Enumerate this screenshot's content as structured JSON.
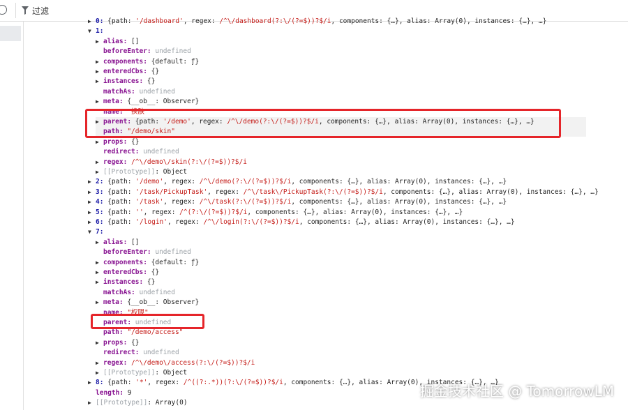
{
  "toolbar": {
    "filter_label": "过滤"
  },
  "rows": [
    {
      "tri": "▶",
      "indent": 0,
      "parts": [
        [
          "kidx",
          "0: "
        ],
        [
          "o",
          "{path: "
        ],
        [
          "s",
          "'/dashboard'"
        ],
        [
          "o",
          ", regex: "
        ],
        [
          "s",
          "/^\\/dashboard(?:\\/(?=$))?$/i"
        ],
        [
          "o",
          ", components: {…}, alias: Array(0), instances: {…},  …}"
        ]
      ]
    },
    {
      "tri": "▼",
      "indent": 0,
      "parts": [
        [
          "kidx",
          "1:"
        ]
      ]
    },
    {
      "tri": "▶",
      "indent": 1,
      "parts": [
        [
          "k",
          "alias: "
        ],
        [
          "o",
          "[]"
        ]
      ]
    },
    {
      "tri": "",
      "indent": 1,
      "parts": [
        [
          "k",
          "beforeEnter: "
        ],
        [
          "u",
          "undefined"
        ]
      ]
    },
    {
      "tri": "▶",
      "indent": 1,
      "parts": [
        [
          "k",
          "components: "
        ],
        [
          "o",
          "{default: ƒ}"
        ]
      ]
    },
    {
      "tri": "▶",
      "indent": 1,
      "parts": [
        [
          "k",
          "enteredCbs: "
        ],
        [
          "o",
          "{}"
        ]
      ]
    },
    {
      "tri": "▶",
      "indent": 1,
      "parts": [
        [
          "k",
          "instances: "
        ],
        [
          "o",
          "{}"
        ]
      ]
    },
    {
      "tri": "",
      "indent": 1,
      "parts": [
        [
          "k",
          "matchAs: "
        ],
        [
          "u",
          "undefined"
        ]
      ]
    },
    {
      "tri": "▶",
      "indent": 1,
      "parts": [
        [
          "k",
          "meta: "
        ],
        [
          "o",
          "{__ob__: Observer}"
        ]
      ]
    },
    {
      "tri": "",
      "indent": 1,
      "parts": [
        [
          "k",
          "name: "
        ],
        [
          "s",
          "\"换肤\""
        ]
      ]
    },
    {
      "tri": "▶",
      "indent": 1,
      "hl": true,
      "parts": [
        [
          "k",
          "parent: "
        ],
        [
          "o",
          "{path: "
        ],
        [
          "s",
          "'/demo'"
        ],
        [
          "o",
          ", regex: "
        ],
        [
          "s",
          "/^\\/demo(?:\\/(?=$))?$/i"
        ],
        [
          "o",
          ", components: {…}, alias: Array(0), instances: {…},  …}"
        ]
      ]
    },
    {
      "tri": "",
      "indent": 1,
      "hl": true,
      "parts": [
        [
          "k",
          "path: "
        ],
        [
          "s",
          "\"/demo/skin\""
        ]
      ]
    },
    {
      "tri": "▶",
      "indent": 1,
      "parts": [
        [
          "k",
          "props: "
        ],
        [
          "o",
          "{}"
        ]
      ]
    },
    {
      "tri": "",
      "indent": 1,
      "parts": [
        [
          "k",
          "redirect: "
        ],
        [
          "u",
          "undefined"
        ]
      ]
    },
    {
      "tri": "▶",
      "indent": 1,
      "parts": [
        [
          "k",
          "regex: "
        ],
        [
          "s",
          "/^\\/demo\\/skin(?:\\/(?=$))?$/i"
        ]
      ]
    },
    {
      "tri": "▶",
      "indent": 1,
      "parts": [
        [
          "u",
          "[[Prototype]]"
        ],
        [
          "o",
          ": Object"
        ]
      ]
    },
    {
      "tri": "▶",
      "indent": 0,
      "parts": [
        [
          "kidx",
          "2: "
        ],
        [
          "o",
          "{path: "
        ],
        [
          "s",
          "'/demo'"
        ],
        [
          "o",
          ", regex: "
        ],
        [
          "s",
          "/^\\/demo(?:\\/(?=$))?$/i"
        ],
        [
          "o",
          ", components: {…}, alias: Array(0), instances: {…},  …}"
        ]
      ]
    },
    {
      "tri": "▶",
      "indent": 0,
      "parts": [
        [
          "kidx",
          "3: "
        ],
        [
          "o",
          "{path: "
        ],
        [
          "s",
          "'/task/PickupTask'"
        ],
        [
          "o",
          ", regex: "
        ],
        [
          "s",
          "/^\\/task\\/PickupTask(?:\\/(?=$))?$/i"
        ],
        [
          "o",
          ", components: {…}, alias: Array(0), instances: {…},  …}"
        ]
      ]
    },
    {
      "tri": "▶",
      "indent": 0,
      "parts": [
        [
          "kidx",
          "4: "
        ],
        [
          "o",
          "{path: "
        ],
        [
          "s",
          "'/task'"
        ],
        [
          "o",
          ", regex: "
        ],
        [
          "s",
          "/^\\/task(?:\\/(?=$))?$/i"
        ],
        [
          "o",
          ", components: {…}, alias: Array(0), instances: {…},  …}"
        ]
      ]
    },
    {
      "tri": "▶",
      "indent": 0,
      "parts": [
        [
          "kidx",
          "5: "
        ],
        [
          "o",
          "{path: "
        ],
        [
          "s",
          "''"
        ],
        [
          "o",
          ", regex: "
        ],
        [
          "s",
          "/^(?:\\/(?=$))?$/i"
        ],
        [
          "o",
          ", components: {…}, alias: Array(0), instances: {…},  …}"
        ]
      ]
    },
    {
      "tri": "▶",
      "indent": 0,
      "parts": [
        [
          "kidx",
          "6: "
        ],
        [
          "o",
          "{path: "
        ],
        [
          "s",
          "'/login'"
        ],
        [
          "o",
          ", regex: "
        ],
        [
          "s",
          "/^\\/login(?:\\/(?=$))?$/i"
        ],
        [
          "o",
          ", components: {…}, alias: Array(0), instances: {…},  …}"
        ]
      ]
    },
    {
      "tri": "▼",
      "indent": 0,
      "parts": [
        [
          "kidx",
          "7:"
        ]
      ]
    },
    {
      "tri": "▶",
      "indent": 1,
      "parts": [
        [
          "k",
          "alias: "
        ],
        [
          "o",
          "[]"
        ]
      ]
    },
    {
      "tri": "",
      "indent": 1,
      "parts": [
        [
          "k",
          "beforeEnter: "
        ],
        [
          "u",
          "undefined"
        ]
      ]
    },
    {
      "tri": "▶",
      "indent": 1,
      "parts": [
        [
          "k",
          "components: "
        ],
        [
          "o",
          "{default: ƒ}"
        ]
      ]
    },
    {
      "tri": "▶",
      "indent": 1,
      "parts": [
        [
          "k",
          "enteredCbs: "
        ],
        [
          "o",
          "{}"
        ]
      ]
    },
    {
      "tri": "▶",
      "indent": 1,
      "parts": [
        [
          "k",
          "instances: "
        ],
        [
          "o",
          "{}"
        ]
      ]
    },
    {
      "tri": "",
      "indent": 1,
      "parts": [
        [
          "k",
          "matchAs: "
        ],
        [
          "u",
          "undefined"
        ]
      ]
    },
    {
      "tri": "▶",
      "indent": 1,
      "parts": [
        [
          "k",
          "meta: "
        ],
        [
          "o",
          "{__ob__: Observer}"
        ]
      ]
    },
    {
      "tri": "",
      "indent": 1,
      "parts": [
        [
          "k",
          "name: "
        ],
        [
          "s",
          "\"权限\""
        ]
      ]
    },
    {
      "tri": "",
      "indent": 1,
      "parts": [
        [
          "k",
          "parent: "
        ],
        [
          "u",
          "undefined"
        ]
      ]
    },
    {
      "tri": "",
      "indent": 1,
      "parts": [
        [
          "k",
          "path: "
        ],
        [
          "s",
          "\"/demo/access\""
        ]
      ]
    },
    {
      "tri": "▶",
      "indent": 1,
      "parts": [
        [
          "k",
          "props: "
        ],
        [
          "o",
          "{}"
        ]
      ]
    },
    {
      "tri": "",
      "indent": 1,
      "parts": [
        [
          "k",
          "redirect: "
        ],
        [
          "u",
          "undefined"
        ]
      ]
    },
    {
      "tri": "▶",
      "indent": 1,
      "parts": [
        [
          "k",
          "regex: "
        ],
        [
          "s",
          "/^\\/demo\\/access(?:\\/(?=$))?$/i"
        ]
      ]
    },
    {
      "tri": "▶",
      "indent": 1,
      "parts": [
        [
          "u",
          "[[Prototype]]"
        ],
        [
          "o",
          ": Object"
        ]
      ]
    },
    {
      "tri": "▶",
      "indent": 0,
      "parts": [
        [
          "kidx",
          "8: "
        ],
        [
          "o",
          "{path: "
        ],
        [
          "s",
          "'*'"
        ],
        [
          "o",
          ", regex: "
        ],
        [
          "s",
          "/^((?:.*))(?:\\/(?=$))?$/i"
        ],
        [
          "o",
          ", components: {…}, alias: Array(0), instances: {…},  …}"
        ]
      ]
    },
    {
      "tri": "",
      "indent": 0,
      "parts": [
        [
          "k",
          "length: "
        ],
        [
          "o",
          "9"
        ]
      ]
    },
    {
      "tri": "▶",
      "indent": 0,
      "parts": [
        [
          "u",
          "[[Prototype]]"
        ],
        [
          "o",
          ": Array(0)"
        ]
      ]
    }
  ],
  "watermark": "掘金技术社区 @ TomorrowLM",
  "colors": {
    "highlight_box": "#e5252a",
    "key": "#881391",
    "string": "#c41a16",
    "undefined": "#9aa0a6"
  }
}
